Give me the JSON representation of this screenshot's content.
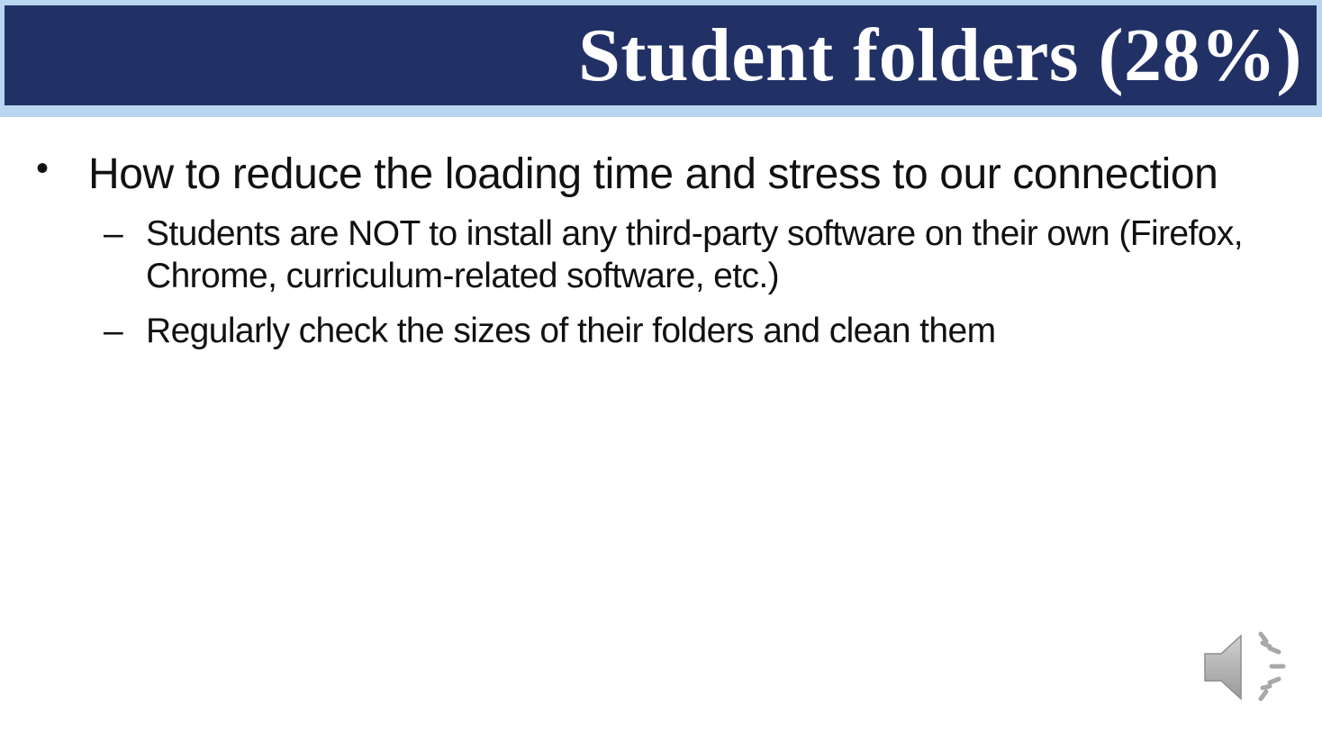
{
  "slide": {
    "title": "Student folders (28%)",
    "bullets": [
      {
        "text": "How to reduce the loading time and stress to our connection",
        "sub_bullets": [
          "Students are NOT to install any third-party software on their own (Firefox, Chrome, curriculum-related software, etc.)",
          "Regularly check the sizes of their folders and clean them"
        ]
      }
    ],
    "bullet_glyph": "•",
    "sub_bullet_glyph": "–"
  },
  "icons": {
    "audio": "speaker-icon"
  },
  "colors": {
    "title_bar": "#213166",
    "title_frame": "#b9d6f0",
    "title_text": "#ffffff",
    "body_text": "#111111"
  }
}
